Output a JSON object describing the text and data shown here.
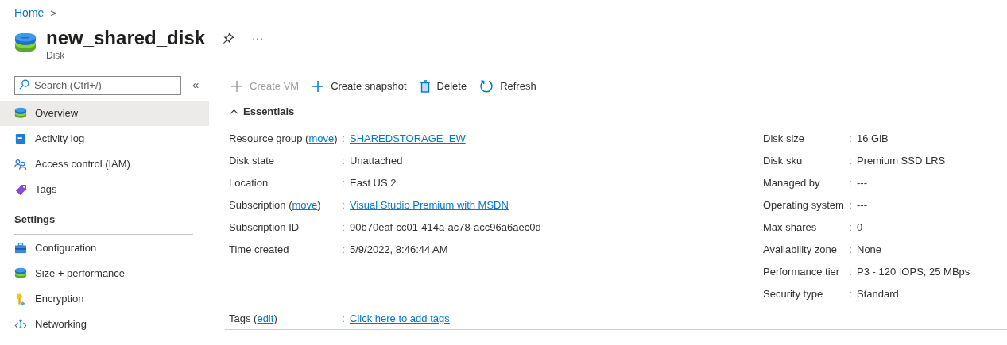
{
  "breadcrumb": {
    "items": [
      "Home"
    ],
    "separator": ">"
  },
  "header": {
    "title": "new_shared_disk",
    "subtitle": "Disk",
    "more": "···"
  },
  "search": {
    "placeholder": "Search (Ctrl+/)"
  },
  "collapse": "«",
  "sidebar": {
    "items": [
      {
        "kind": "item",
        "label": "Overview",
        "selected": true
      },
      {
        "kind": "item",
        "label": "Activity log",
        "selected": false
      },
      {
        "kind": "item",
        "label": "Access control (IAM)",
        "selected": false
      },
      {
        "kind": "item",
        "label": "Tags",
        "selected": false
      },
      {
        "kind": "header",
        "label": "Settings"
      },
      {
        "kind": "item",
        "label": "Configuration",
        "selected": false
      },
      {
        "kind": "item",
        "label": "Size + performance",
        "selected": false
      },
      {
        "kind": "item",
        "label": "Encryption",
        "selected": false
      },
      {
        "kind": "item",
        "label": "Networking",
        "selected": false
      }
    ]
  },
  "toolbar": [
    {
      "label": "Create VM",
      "disabled": true
    },
    {
      "label": "Create snapshot",
      "disabled": false
    },
    {
      "label": "Delete",
      "disabled": false
    },
    {
      "label": "Refresh",
      "disabled": false
    }
  ],
  "essentials": {
    "title": "Essentials",
    "left": [
      {
        "label": "Resource group (",
        "action": "move",
        "label_after": ")",
        "separator": ":",
        "value": "SHAREDSTORAGE_EW",
        "link": true
      },
      {
        "label": "Disk state",
        "separator": ":",
        "value": "Unattached",
        "link": false
      },
      {
        "label": "Location",
        "separator": ":",
        "value": "East US 2",
        "link": false
      },
      {
        "label": "Subscription (",
        "action": "move",
        "label_after": ")",
        "separator": ":",
        "value": "Visual Studio Premium with MSDN",
        "link": true
      },
      {
        "label": "Subscription ID",
        "separator": ":",
        "value": "90b70eaf-cc01-414a-ac78-acc96a6aec0d",
        "link": false
      },
      {
        "label": "Time created",
        "separator": ":",
        "value": "5/9/2022, 8:46:44 AM",
        "link": false
      }
    ],
    "right": [
      {
        "label": "Disk size",
        "separator": ":",
        "value": "16 GiB",
        "link": false
      },
      {
        "label": "Disk sku",
        "separator": ":",
        "value": "Premium SSD LRS",
        "link": false
      },
      {
        "label": "Managed by",
        "separator": ":",
        "value": "---",
        "link": false
      },
      {
        "label": "Operating system",
        "separator": ":",
        "value": "---",
        "link": false
      },
      {
        "label": "Max shares",
        "separator": ":",
        "value": "0",
        "link": false
      },
      {
        "label": "Availability zone",
        "separator": ":",
        "value": "None",
        "link": false
      },
      {
        "label": "Performance tier",
        "separator": ":",
        "value": "P3 - 120 IOPS, 25 MBps",
        "link": false
      },
      {
        "label": "Security type",
        "separator": ":",
        "value": "Standard",
        "link": false
      }
    ],
    "tags": {
      "label": "Tags (",
      "action": "edit",
      "label_after": ")",
      "separator": ":",
      "value": "Click here to add tags",
      "link": true
    }
  }
}
